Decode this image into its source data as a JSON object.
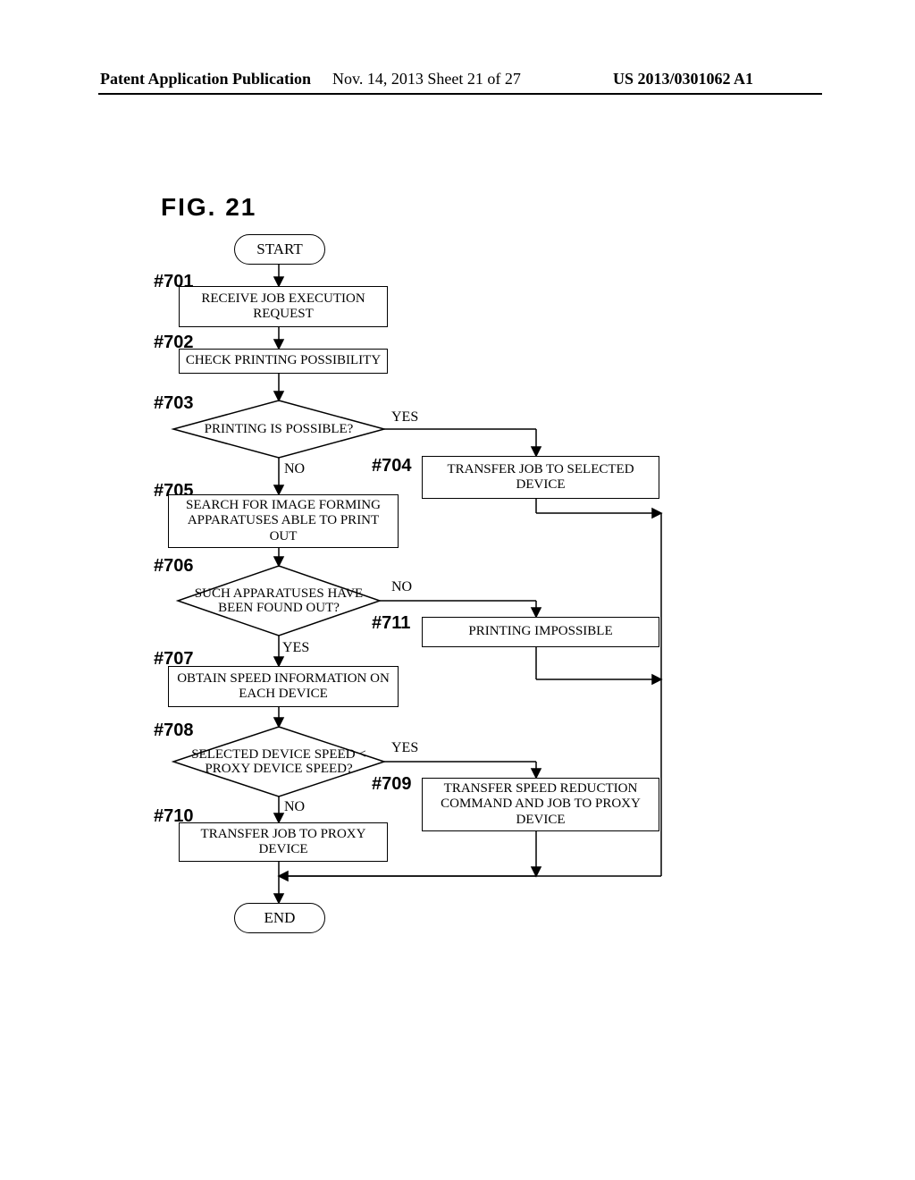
{
  "header": {
    "left": "Patent Application Publication",
    "center": "Nov. 14, 2013  Sheet 21 of 27",
    "right": "US 2013/0301062 A1"
  },
  "figure_title": "FIG. 21",
  "nodes": {
    "start": "START",
    "end": "END",
    "s701": {
      "label": "#701",
      "text": "RECEIVE JOB EXECUTION REQUEST"
    },
    "s702": {
      "label": "#702",
      "text": "CHECK PRINTING POSSIBILITY"
    },
    "s703": {
      "label": "#703",
      "text": "PRINTING IS POSSIBLE?",
      "yes": "YES",
      "no": "NO"
    },
    "s704": {
      "label": "#704",
      "text": "TRANSFER JOB TO SELECTED DEVICE"
    },
    "s705": {
      "label": "#705",
      "text": "SEARCH FOR IMAGE FORMING APPARATUSES ABLE TO PRINT OUT"
    },
    "s706": {
      "label": "#706",
      "text": "SUCH APPARATUSES HAVE BEEN FOUND OUT?",
      "yes": "YES",
      "no": "NO"
    },
    "s707": {
      "label": "#707",
      "text": "OBTAIN SPEED INFORMATION ON EACH DEVICE"
    },
    "s708": {
      "label": "#708",
      "text": "SELECTED DEVICE SPEED < PROXY DEVICE SPEED?",
      "yes": "YES",
      "no": "NO"
    },
    "s709": {
      "label": "#709",
      "text": "TRANSFER SPEED REDUCTION COMMAND AND JOB TO PROXY DEVICE"
    },
    "s710": {
      "label": "#710",
      "text": "TRANSFER JOB TO PROXY DEVICE"
    },
    "s711": {
      "label": "#711",
      "text": "PRINTING IMPOSSIBLE"
    }
  }
}
